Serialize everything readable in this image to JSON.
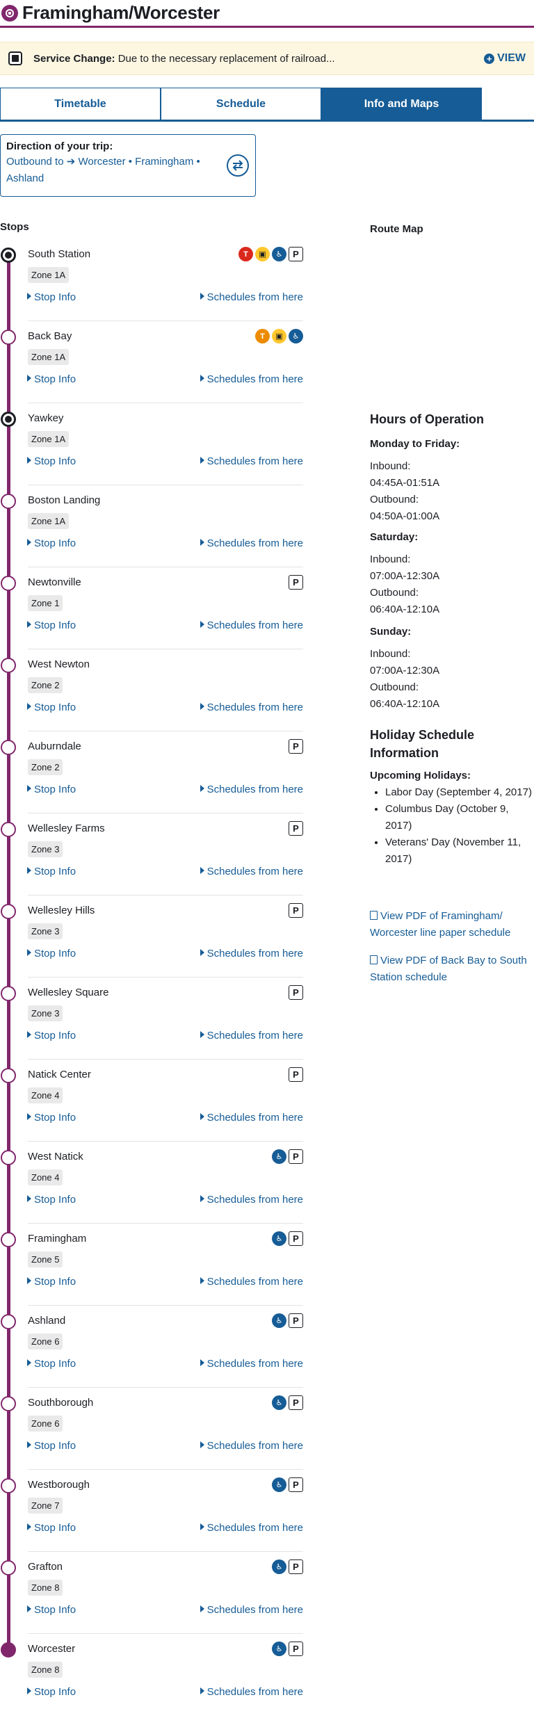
{
  "header": {
    "title": "Framingham/Worcester",
    "route_color": "#80276c"
  },
  "alert": {
    "label": "Service Change:",
    "text": "Due to the necessary replacement of railroad...",
    "view_label": "VIEW"
  },
  "tabs": [
    {
      "label": "Timetable",
      "active": false
    },
    {
      "label": "Schedule",
      "active": false
    },
    {
      "label": "Info and Maps",
      "active": true
    }
  ],
  "direction": {
    "label": "Direction of your trip:",
    "prefix": "Outbound to",
    "destination": "Worcester • Framingham • Ashland"
  },
  "stops_heading": "Stops",
  "stop_links": {
    "stop_info": "Stop Info",
    "schedules": "Schedules from here"
  },
  "stops": [
    {
      "name": "South Station",
      "zone": "Zone 1A",
      "marker": "hub",
      "features": [
        "red-line",
        "commuter-rail",
        "accessible",
        "parking"
      ]
    },
    {
      "name": "Back Bay",
      "zone": "Zone 1A",
      "marker": "normal",
      "features": [
        "orange-line",
        "commuter-rail",
        "accessible"
      ]
    },
    {
      "name": "Yawkey",
      "zone": "Zone 1A",
      "marker": "hub",
      "features": []
    },
    {
      "name": "Boston Landing",
      "zone": "Zone 1A",
      "marker": "normal",
      "features": []
    },
    {
      "name": "Newtonville",
      "zone": "Zone 1",
      "marker": "normal",
      "features": [
        "parking"
      ]
    },
    {
      "name": "West Newton",
      "zone": "Zone 2",
      "marker": "normal",
      "features": []
    },
    {
      "name": "Auburndale",
      "zone": "Zone 2",
      "marker": "normal",
      "features": [
        "parking"
      ]
    },
    {
      "name": "Wellesley Farms",
      "zone": "Zone 3",
      "marker": "normal",
      "features": [
        "parking"
      ]
    },
    {
      "name": "Wellesley Hills",
      "zone": "Zone 3",
      "marker": "normal",
      "features": [
        "parking"
      ]
    },
    {
      "name": "Wellesley Square",
      "zone": "Zone 3",
      "marker": "normal",
      "features": [
        "parking"
      ]
    },
    {
      "name": "Natick Center",
      "zone": "Zone 4",
      "marker": "normal",
      "features": [
        "parking"
      ]
    },
    {
      "name": "West Natick",
      "zone": "Zone 4",
      "marker": "normal",
      "features": [
        "accessible",
        "parking"
      ]
    },
    {
      "name": "Framingham",
      "zone": "Zone 5",
      "marker": "normal",
      "features": [
        "accessible",
        "parking"
      ]
    },
    {
      "name": "Ashland",
      "zone": "Zone 6",
      "marker": "normal",
      "features": [
        "accessible",
        "parking"
      ]
    },
    {
      "name": "Southborough",
      "zone": "Zone 6",
      "marker": "normal",
      "features": [
        "accessible",
        "parking"
      ]
    },
    {
      "name": "Westborough",
      "zone": "Zone 7",
      "marker": "normal",
      "features": [
        "accessible",
        "parking"
      ]
    },
    {
      "name": "Grafton",
      "zone": "Zone 8",
      "marker": "normal",
      "features": [
        "accessible",
        "parking"
      ]
    },
    {
      "name": "Worcester",
      "zone": "Zone 8",
      "marker": "terminal",
      "features": [
        "accessible",
        "parking"
      ]
    }
  ],
  "feature_glyphs": {
    "parking": "P",
    "red-line": "T",
    "orange-line": "T",
    "commuter-rail": "▣",
    "accessible": "♿"
  },
  "sidebar": {
    "route_map_heading": "Route Map",
    "hours_heading": "Hours of Operation",
    "days": [
      {
        "day": "Monday to Friday:",
        "inbound_label": "Inbound:",
        "inbound": "04:45A-01:51A",
        "outbound_label": "Outbound:",
        "outbound": "04:50A-01:00A"
      },
      {
        "day": "Saturday:",
        "inbound_label": "Inbound:",
        "inbound": "07:00A-12:30A",
        "outbound_label": "Outbound:",
        "outbound": "06:40A-12:10A"
      },
      {
        "day": "Sunday:",
        "inbound_label": "Inbound:",
        "inbound": "07:00A-12:30A",
        "outbound_label": "Outbound:",
        "outbound": "06:40A-12:10A"
      }
    ],
    "holiday_heading": "Holiday Schedule Information",
    "upcoming_heading": "Upcoming Holidays:",
    "holidays": [
      "Labor Day (September 4, 2017)",
      "Columbus Day (October 9, 2017)",
      "Veterans' Day (November 11, 2017)"
    ],
    "pdf_links": [
      "View PDF of Framingham/ Worcester line paper schedule",
      "View PDF of Back Bay to South Station schedule"
    ]
  }
}
